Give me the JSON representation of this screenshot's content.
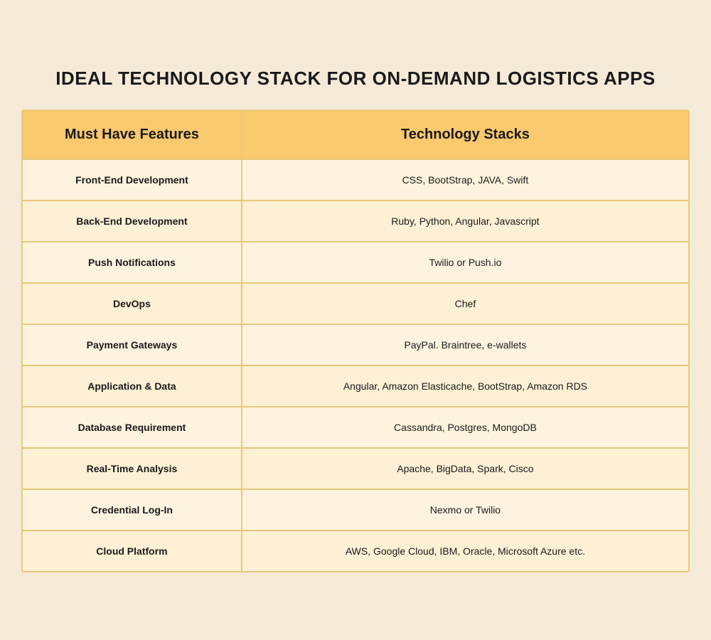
{
  "title": "IDEAL TECHNOLOGY STACK FOR ON-DEMAND LOGISTICS APPS",
  "header": {
    "col1": "Must Have Features",
    "col2": "Technology Stacks"
  },
  "rows": [
    {
      "feature": "Front-End Development",
      "stack": "CSS, BootStrap, JAVA, Swift"
    },
    {
      "feature": "Back-End Development",
      "stack": "Ruby, Python, Angular, Javascript"
    },
    {
      "feature": "Push Notifications",
      "stack": "Twilio or Push.io"
    },
    {
      "feature": "DevOps",
      "stack": "Chef"
    },
    {
      "feature": "Payment Gateways",
      "stack": "PayPal. Braintree, e-wallets"
    },
    {
      "feature": "Application & Data",
      "stack": "Angular, Amazon Elasticache, BootStrap, Amazon RDS"
    },
    {
      "feature": "Database Requirement",
      "stack": "Cassandra, Postgres, MongoDB"
    },
    {
      "feature": "Real-Time Analysis",
      "stack": "Apache, BigData, Spark, Cisco"
    },
    {
      "feature": "Credential Log-In",
      "stack": "Nexmo or Twilio"
    },
    {
      "feature": "Cloud Platform",
      "stack": "AWS, Google Cloud, IBM, Oracle, Microsoft Azure etc."
    }
  ]
}
